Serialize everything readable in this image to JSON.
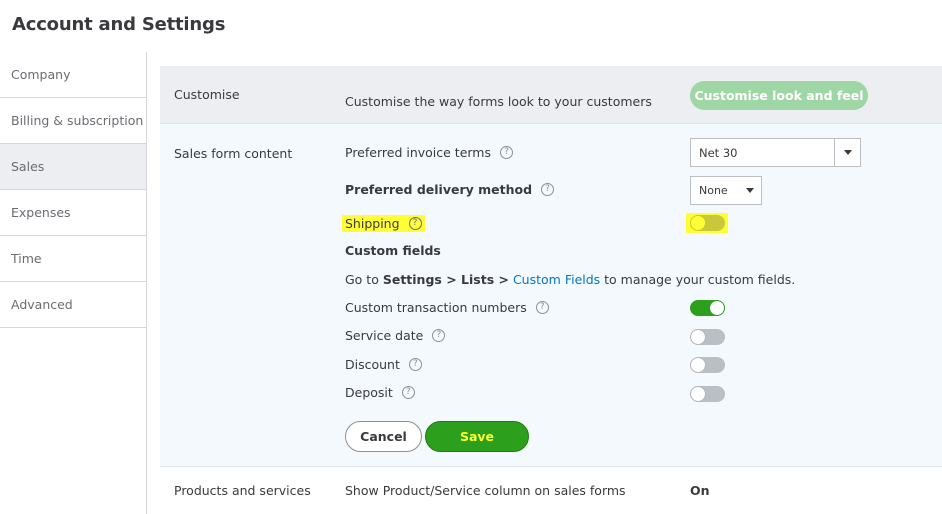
{
  "page": {
    "title": "Account and Settings"
  },
  "sidebar": {
    "items": [
      {
        "label": "Company",
        "active": false
      },
      {
        "label": "Billing & subscription",
        "active": false
      },
      {
        "label": "Sales",
        "active": true
      },
      {
        "label": "Expenses",
        "active": false
      },
      {
        "label": "Time",
        "active": false
      },
      {
        "label": "Advanced",
        "active": false
      }
    ]
  },
  "customise": {
    "title": "Customise",
    "description": "Customise the way forms look to your customers",
    "button": "Customise look and feel"
  },
  "sales_form": {
    "title": "Sales form content",
    "invoice_terms_label": "Preferred invoice terms",
    "invoice_terms_value": "Net 30",
    "delivery_label": "Preferred delivery method",
    "delivery_value": "None",
    "shipping_label": "Shipping",
    "shipping_on": false,
    "custom_fields_heading": "Custom fields",
    "custom_fields_desc": {
      "prefix": "Go to ",
      "path": "Settings > Lists >",
      "link": "Custom Fields",
      "suffix": " to manage your custom fields."
    },
    "toggles": [
      {
        "label": "Custom transaction numbers",
        "on": true
      },
      {
        "label": "Service date",
        "on": false
      },
      {
        "label": "Discount",
        "on": false
      },
      {
        "label": "Deposit",
        "on": false
      }
    ],
    "cancel_label": "Cancel",
    "save_label": "Save"
  },
  "products": {
    "title": "Products and services",
    "row_label": "Show Product/Service column on sales forms",
    "row_value": "On"
  },
  "icons": {
    "help": "question-circle-icon",
    "dropdown": "caret-down-icon"
  },
  "colors": {
    "green": "#2ca01c",
    "link": "#0077c5",
    "highlight": "#ffff33"
  }
}
